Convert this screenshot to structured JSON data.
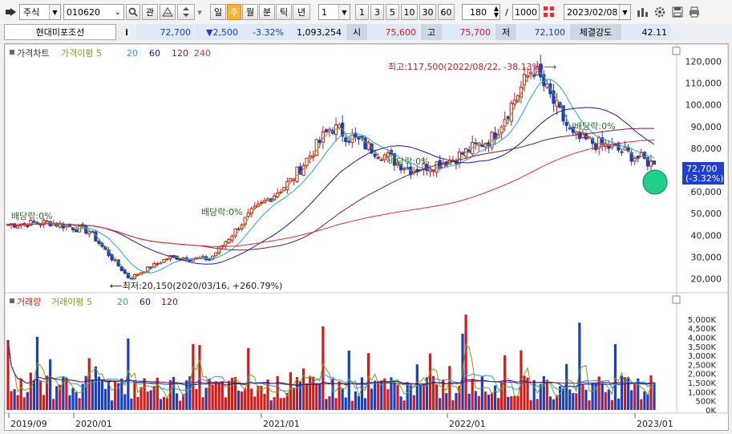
{
  "toolbar": {
    "market": "주식",
    "code": "010620",
    "zoom_btn": "관",
    "period_tabs": [
      "일",
      "주",
      "월",
      "분",
      "틱",
      "년"
    ],
    "interval_value": "1",
    "interval_tabs": [
      "1",
      "3",
      "5",
      "10",
      "30",
      "60"
    ],
    "count": "180",
    "slash": "/",
    "total": "1000",
    "date": "2023/02/08"
  },
  "info": {
    "name": "현대미포조선",
    "info_btn": "i",
    "price": "72,700",
    "change": "▼2,500",
    "change_rate": "-3.32%",
    "volume": "1,093,254",
    "open_label": "시",
    "open": "75,600",
    "high_label": "고",
    "high": "75,700",
    "low_label": "저",
    "low": "72,100",
    "strength_label": "체결강도",
    "strength": "42.11"
  },
  "price_panel": {
    "title": "가격차트",
    "ma_label": "가격이평",
    "ma_periods": [
      "5",
      "20",
      "60",
      "120",
      "240"
    ],
    "ma_colors": [
      "#7e9d1e",
      "#2aa0d4",
      "#1a1aa8",
      "#7a1a4a",
      "#e03030"
    ],
    "y_ticks": [
      "120,000",
      "110,000",
      "100,000",
      "90,000",
      "80,000",
      "70,000",
      "60,000",
      "50,000",
      "40,000",
      "30,000",
      "20,000"
    ],
    "high_note": "최고:117,500(2022/08/22, -38.13%)⟶",
    "low_note": "⟵최저:20,150(2020/03/16, +260.79%)",
    "dividend_notes": [
      "배당락:0%",
      "배당락:0%",
      "배당락:0%",
      "배당락:0%"
    ],
    "current_price": "72,700",
    "current_rate": "(-3.32%)"
  },
  "volume_panel": {
    "title": "거래량",
    "ma_label": "거래이평",
    "ma_periods": [
      "5",
      "20",
      "60",
      "120"
    ],
    "y_ticks": [
      "5,000K",
      "4,500K",
      "4,000K",
      "3,500K",
      "3,000K",
      "2,500K",
      "2,000K",
      "1,500K",
      "1,000K",
      "500K",
      "0K"
    ]
  },
  "x_axis": [
    "2019/09",
    "2020/01",
    "2021/01",
    "2022/01",
    "2023/01"
  ],
  "chart_data": {
    "type": "candlestick",
    "title": "가격차트",
    "interval": "monthly-ish daily candles (approximate trend)",
    "price_trend": [
      {
        "date": "2019/09",
        "close": 45000
      },
      {
        "date": "2019/12",
        "close": 46000
      },
      {
        "date": "2020/01",
        "close": 42000
      },
      {
        "date": "2020/03",
        "close": 20150
      },
      {
        "date": "2020/06",
        "close": 30000
      },
      {
        "date": "2020/10",
        "close": 29000
      },
      {
        "date": "2021/01",
        "close": 50000
      },
      {
        "date": "2021/04",
        "close": 65000
      },
      {
        "date": "2021/06",
        "close": 90000
      },
      {
        "date": "2021/09",
        "close": 80000
      },
      {
        "date": "2021/12",
        "close": 70000
      },
      {
        "date": "2022/03",
        "close": 75000
      },
      {
        "date": "2022/06",
        "close": 85000
      },
      {
        "date": "2022/08",
        "close": 117500
      },
      {
        "date": "2022/11",
        "close": 85000
      },
      {
        "date": "2023/01",
        "close": 80000
      },
      {
        "date": "2023/02",
        "close": 72700
      }
    ],
    "y_range": [
      15000,
      125000
    ],
    "volume_range_k": [
      0,
      5300
    ]
  }
}
